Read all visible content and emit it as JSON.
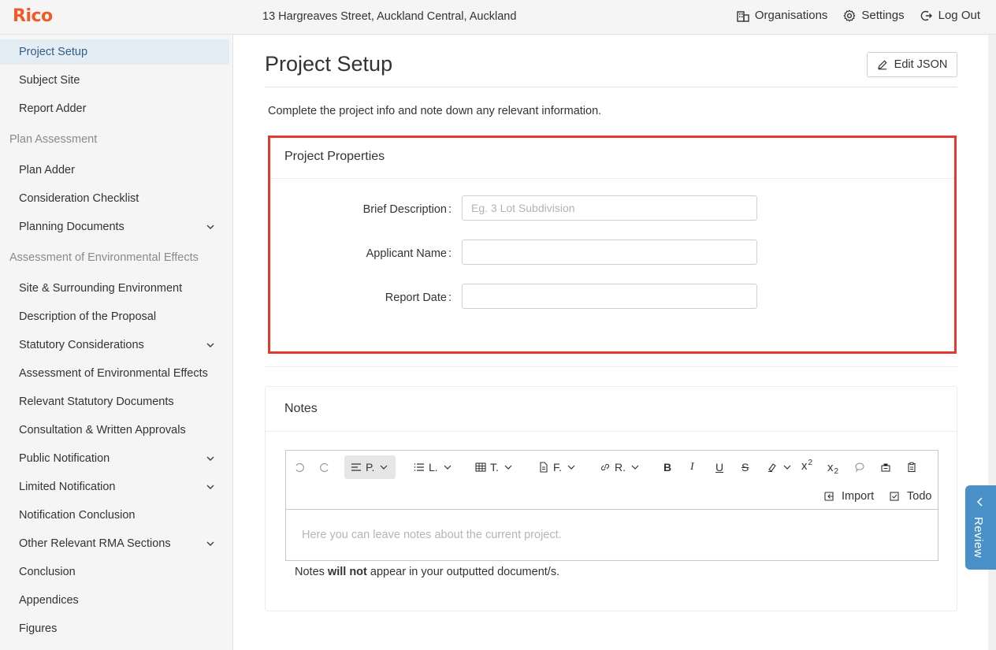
{
  "app": {
    "logo": "Rico",
    "address": "13 Hargreaves Street, Auckland Central, Auckland"
  },
  "topnav": {
    "organisations": "Organisations",
    "settings": "Settings",
    "logout": "Log Out"
  },
  "sidebar": {
    "items": [
      {
        "label": "Project Setup"
      },
      {
        "label": "Subject Site"
      },
      {
        "label": "Report Adder"
      },
      {
        "label": "Plan Adder"
      },
      {
        "label": "Consideration Checklist"
      },
      {
        "label": "Planning Documents"
      },
      {
        "label": "Site & Surrounding Environment"
      },
      {
        "label": "Description of the Proposal"
      },
      {
        "label": "Statutory Considerations"
      },
      {
        "label": "Assessment of Environmental Effects"
      },
      {
        "label": "Relevant Statutory Documents"
      },
      {
        "label": "Consultation & Written Approvals"
      },
      {
        "label": "Public Notification"
      },
      {
        "label": "Limited Notification"
      },
      {
        "label": "Notification Conclusion"
      },
      {
        "label": "Other Relevant RMA Sections"
      },
      {
        "label": "Conclusion"
      },
      {
        "label": "Appendices"
      },
      {
        "label": "Figures"
      }
    ],
    "groups": {
      "plan_assessment": "Plan Assessment",
      "aee": "Assessment of Environmental Effects"
    }
  },
  "main": {
    "title": "Project Setup",
    "edit_json": "Edit JSON",
    "intro": "Complete the project info and note down any relevant information."
  },
  "properties": {
    "title": "Project Properties",
    "brief_label": "Brief Description",
    "brief_placeholder": "Eg. 3 Lot Subdivision",
    "brief_value": "",
    "applicant_label": "Applicant Name",
    "applicant_value": "",
    "date_label": "Report Date",
    "date_value": "",
    "colon": ":"
  },
  "notes": {
    "title": "Notes",
    "toolbar": {
      "paragraph": "P.",
      "list": "L.",
      "table": "T.",
      "file": "F.",
      "link": "R.",
      "bold": "B",
      "italic": "I",
      "underline": "U",
      "strike": "S",
      "superscript": "x",
      "superscript_mark": "2",
      "subscript": "x",
      "subscript_mark": "2",
      "import": "Import",
      "todo": "Todo"
    },
    "placeholder": "Here you can leave notes about the current project.",
    "footer_pre": "Notes ",
    "footer_bold": "will not",
    "footer_post": " appear in your outputted document/s."
  },
  "review": {
    "label": "Review"
  },
  "colors": {
    "accent": "#f05a28",
    "highlight": "#e23b2e",
    "review": "#4a90c8",
    "active_bg": "#e4ecf4"
  }
}
